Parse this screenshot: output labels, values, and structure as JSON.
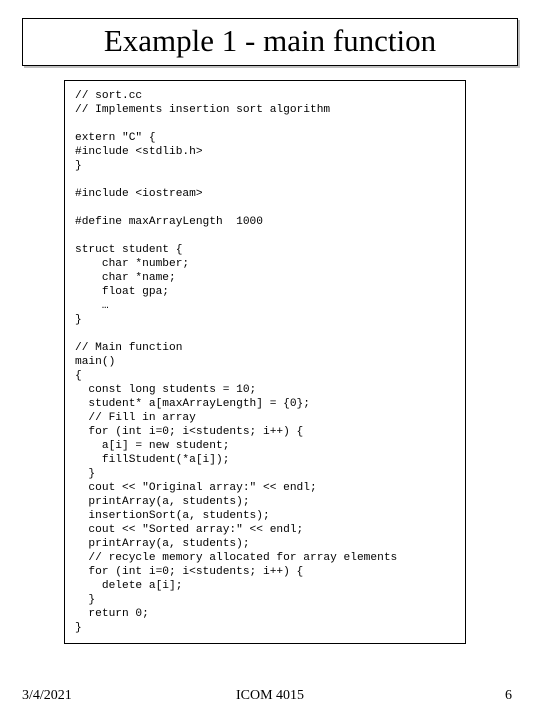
{
  "title": "Example 1 - main function",
  "code": "// sort.cc\n// Implements insertion sort algorithm\n\nextern \"C\" {\n#include <stdlib.h>\n}\n\n#include <iostream>\n\n#define maxArrayLength  1000\n\nstruct student {\n    char *number;\n    char *name;\n    float gpa;\n    …\n}\n\n// Main function\nmain()\n{\n  const long students = 10;\n  student* a[maxArrayLength] = {0};\n  // Fill in array\n  for (int i=0; i<students; i++) {\n    a[i] = new student;\n    fillStudent(*a[i]);\n  }\n  cout << \"Original array:\" << endl;\n  printArray(a, students);\n  insertionSort(a, students);\n  cout << \"Sorted array:\" << endl;\n  printArray(a, students);\n  // recycle memory allocated for array elements\n  for (int i=0; i<students; i++) {\n    delete a[i];\n  }\n  return 0;\n}",
  "footer": {
    "date": "3/4/2021",
    "course": "ICOM 4015",
    "page": "6"
  }
}
